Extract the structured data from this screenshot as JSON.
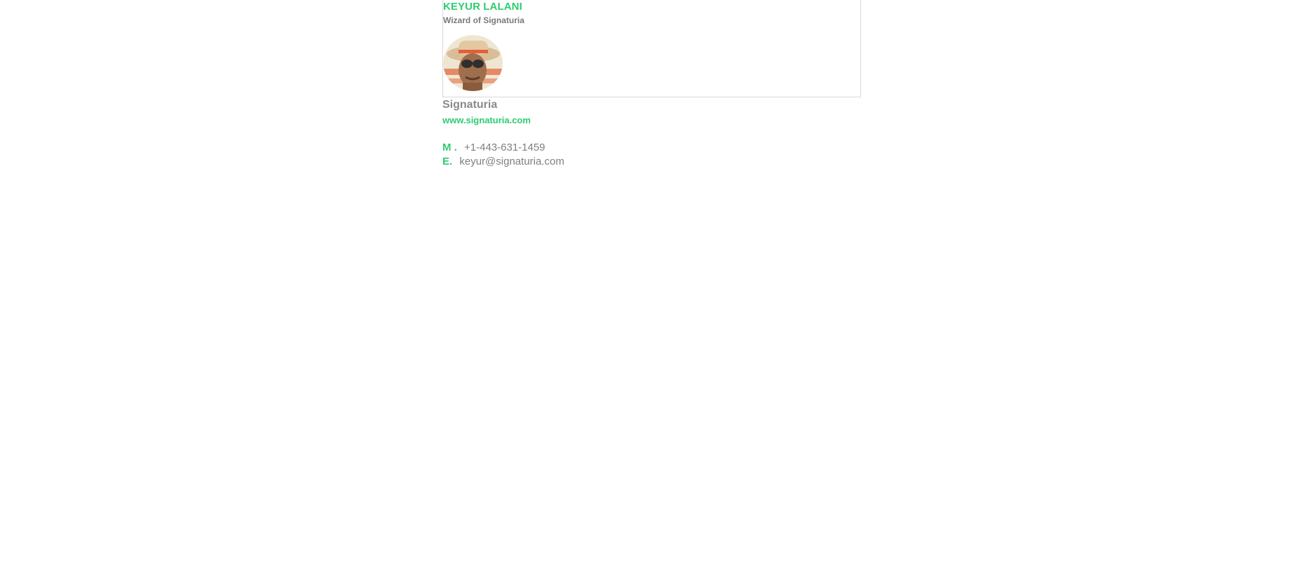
{
  "signature": {
    "name": "KEYUR LALANI",
    "job_title": "Wizard of Signaturia",
    "company": "Signaturia",
    "website": "www.signaturia.com",
    "mobile_label": "M .",
    "mobile_value": "+1-443-631-1459",
    "email_label": "E.",
    "email_value": "keyur@signaturia.com"
  },
  "colors": {
    "accent": "#2ecc71",
    "muted_text": "#7f7f7f",
    "border": "#d9d9d9"
  },
  "icons": {
    "avatar": "profile-photo"
  }
}
